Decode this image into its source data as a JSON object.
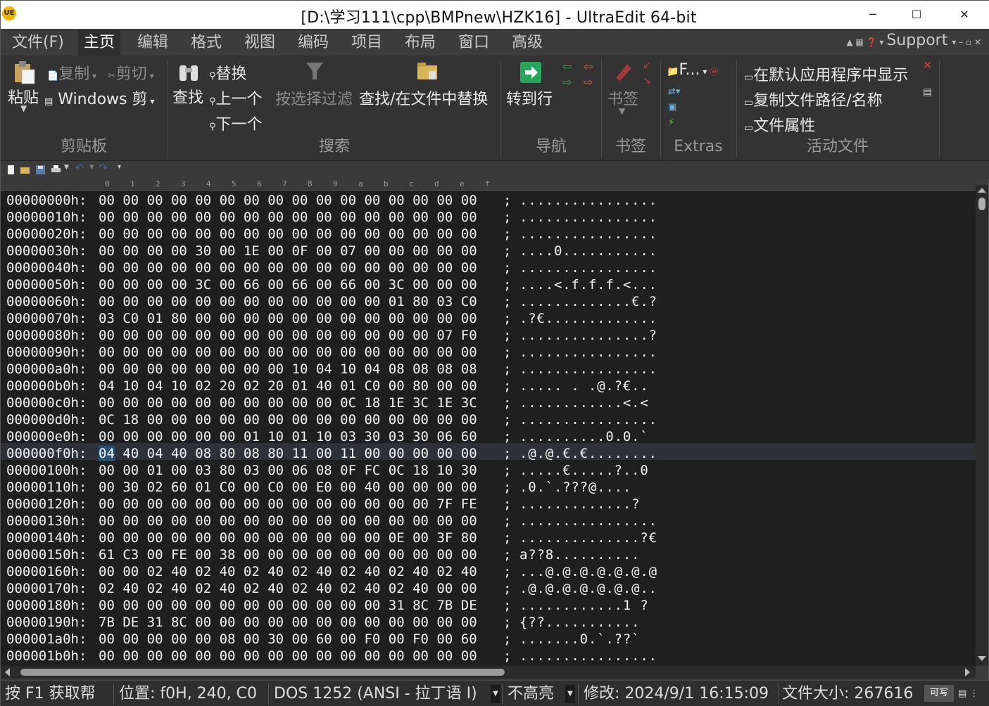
{
  "window": {
    "title": "[D:\\学习111\\cpp\\BMPnew\\HZK16] - UltraEdit 64-bit",
    "app_icon": "UE",
    "minimize": "─",
    "maximize": "☐",
    "close": "✕"
  },
  "menu": {
    "tabs": [
      "文件(F)",
      "主页",
      "编辑",
      "格式",
      "视图",
      "编码",
      "项目",
      "布局",
      "窗口",
      "高级"
    ],
    "active": "主页",
    "support": "Support"
  },
  "ribbon": {
    "clipboard": {
      "paste": "粘贴",
      "copy": "复制",
      "cut": "剪切",
      "windows_label": "Windows 剪",
      "group": "剪贴板"
    },
    "search": {
      "find": "查找",
      "replace": "替换",
      "prev": "上一个",
      "next": "下一个",
      "filter": "按选择过滤",
      "find_in_files": "查找/在文件中替换",
      "group": "搜索"
    },
    "navigation": {
      "goto": "转到行",
      "group": "导航"
    },
    "bookmarks": {
      "bookmark": "书签",
      "group": "书签"
    },
    "extras": {
      "label": "F...",
      "group": "Extras"
    },
    "active_file": {
      "show_default": "在默认应用程序中显示",
      "copy_path": "复制文件路径/名称",
      "properties": "文件属性",
      "group": "活动文件"
    }
  },
  "ruler": [
    "0",
    "1",
    "2",
    "3",
    "4",
    "5",
    "6",
    "7",
    "8",
    "9",
    "a",
    "b",
    "c",
    "d",
    "e",
    "f"
  ],
  "hex": {
    "current_line": 15,
    "rows": [
      {
        "addr": "00000000h:",
        "bytes": "00 00 00 00 00 00 00 00 00 00 00 00 00 00 00 00",
        "ascii": "................"
      },
      {
        "addr": "00000010h:",
        "bytes": "00 00 00 00 00 00 00 00 00 00 00 00 00 00 00 00",
        "ascii": "................"
      },
      {
        "addr": "00000020h:",
        "bytes": "00 00 00 00 00 00 00 00 00 00 00 00 00 00 00 00",
        "ascii": "................"
      },
      {
        "addr": "00000030h:",
        "bytes": "00 00 00 00 30 00 1E 00 0F 00 07 00 00 00 00 00",
        "ascii": "....0..........."
      },
      {
        "addr": "00000040h:",
        "bytes": "00 00 00 00 00 00 00 00 00 00 00 00 00 00 00 00",
        "ascii": "................"
      },
      {
        "addr": "00000050h:",
        "bytes": "00 00 00 00 3C 00 66 00 66 00 66 00 3C 00 00 00",
        "ascii": "....<.f.f.f.<..."
      },
      {
        "addr": "00000060h:",
        "bytes": "00 00 00 00 00 00 00 00 00 00 00 00 01 80 03 C0",
        "ascii": ".............€.?"
      },
      {
        "addr": "00000070h:",
        "bytes": "03 C0 01 80 00 00 00 00 00 00 00 00 00 00 00 00",
        "ascii": ".?€............."
      },
      {
        "addr": "00000080h:",
        "bytes": "00 00 00 00 00 00 00 00 00 00 00 00 00 00 07 F0",
        "ascii": "...............?"
      },
      {
        "addr": "00000090h:",
        "bytes": "00 00 00 00 00 00 00 00 00 00 00 00 00 00 00 00",
        "ascii": "................"
      },
      {
        "addr": "000000a0h:",
        "bytes": "00 00 00 00 00 00 00 00 10 04 10 04 08 08 08 08",
        "ascii": "................"
      },
      {
        "addr": "000000b0h:",
        "bytes": "04 10 04 10 02 20 02 20 01 40 01 C0 00 80 00 00",
        "ascii": "..... . .@.?€.."
      },
      {
        "addr": "000000c0h:",
        "bytes": "00 00 00 00 00 00 00 00 00 00 0C 18 1E 3C 1E 3C",
        "ascii": "............<.<"
      },
      {
        "addr": "000000d0h:",
        "bytes": "0C 18 00 00 00 00 00 00 00 00 00 00 00 00 00 00",
        "ascii": "................"
      },
      {
        "addr": "000000e0h:",
        "bytes": "00 00 00 00 00 00 01 10 01 10 03 30 03 30 06 60",
        "ascii": "..........0.0.`"
      },
      {
        "addr": "000000f0h:",
        "bytes": "04 40 04 40 08 80 08 80 11 00 11 00 00 00 00 00",
        "ascii": ".@.@.€.€........"
      },
      {
        "addr": "00000100h:",
        "bytes": "00 00 01 00 03 80 03 00 06 08 0F FC 0C 18 10 30",
        "ascii": ".....€.....?..0"
      },
      {
        "addr": "00000110h:",
        "bytes": "00 30 02 60 01 C0 00 C0 00 E0 00 40 00 00 00 00",
        "ascii": ".0.`.???@...."
      },
      {
        "addr": "00000120h:",
        "bytes": "00 00 00 00 00 00 00 00 00 00 00 00 00 00 7F FE",
        "ascii": ".............?"
      },
      {
        "addr": "00000130h:",
        "bytes": "00 00 00 00 00 00 00 00 00 00 00 00 00 00 00 00",
        "ascii": "................"
      },
      {
        "addr": "00000140h:",
        "bytes": "00 00 00 00 00 00 00 00 00 00 00 00 0E 00 3F 80",
        "ascii": "..............?€"
      },
      {
        "addr": "00000150h:",
        "bytes": "61 C3 00 FE 00 38 00 00 00 00 00 00 00 00 00 00",
        "ascii": "a??8.........."
      },
      {
        "addr": "00000160h:",
        "bytes": "00 00 02 40 02 40 02 40 02 40 02 40 02 40 02 40",
        "ascii": "...@.@.@.@.@.@.@"
      },
      {
        "addr": "00000170h:",
        "bytes": "02 40 02 40 02 40 02 40 02 40 02 40 02 40 00 00",
        "ascii": ".@.@.@.@.@.@.@.."
      },
      {
        "addr": "00000180h:",
        "bytes": "00 00 00 00 00 00 00 00 00 00 00 00 31 8C 7B DE",
        "ascii": "............1 ?"
      },
      {
        "addr": "00000190h:",
        "bytes": "7B DE 31 8C 00 00 00 00 00 00 00 00 00 00 00 00",
        "ascii": "{??..........."
      },
      {
        "addr": "000001a0h:",
        "bytes": "00 00 00 00 00 08 00 30 00 60 00 F0 00 F0 00 60",
        "ascii": ".......0.`.??`"
      },
      {
        "addr": "000001b0h:",
        "bytes": "00 00 00 00 00 00 00 00 00 00 00 00 00 00 00 00",
        "ascii": "................"
      }
    ]
  },
  "status": {
    "help": "按 F1 获取帮",
    "position": "位置: f0H, 240, C0",
    "encoding": "DOS 1252  (ANSI - 拉丁语 I)",
    "highlight": "不高亮",
    "modified": "修改:   2024/9/1 16:15:09",
    "filesize": "文件大小:   267616",
    "rw": "可写"
  }
}
